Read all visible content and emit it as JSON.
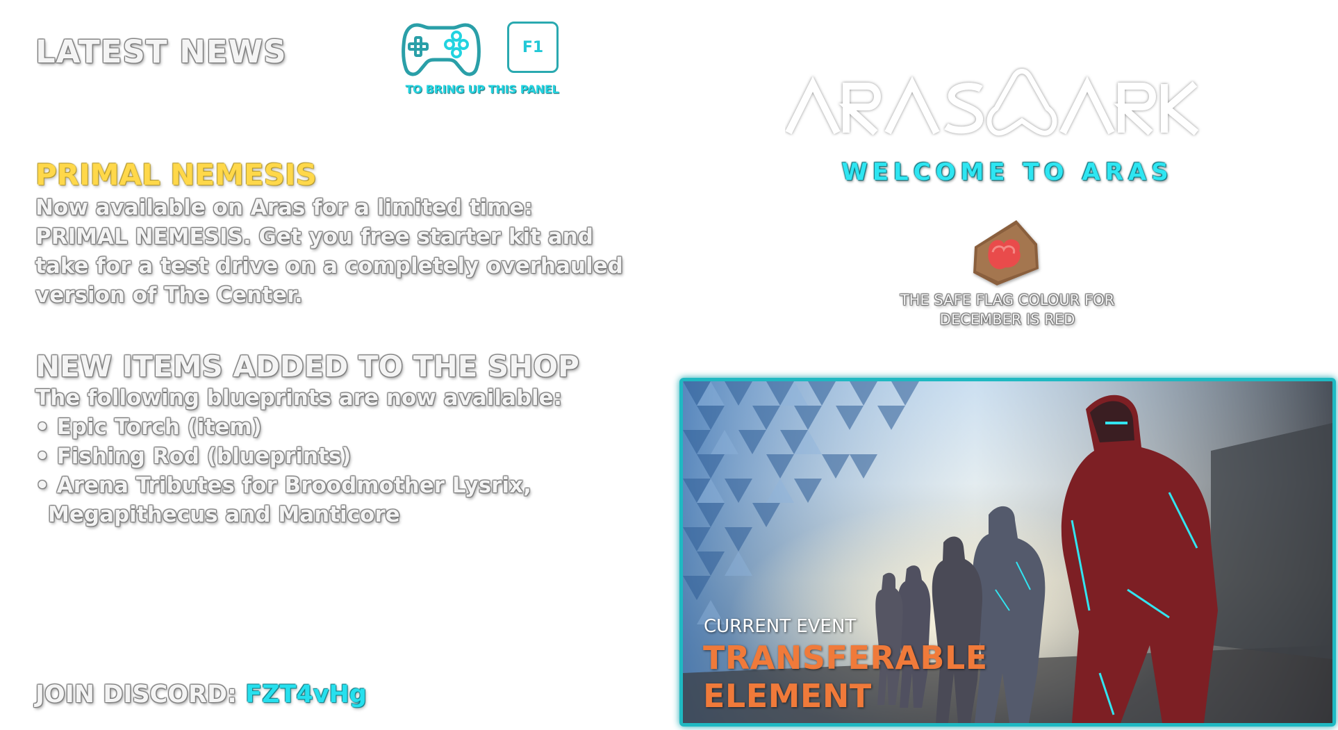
{
  "header": {
    "title": "LATEST NEWS",
    "hint_label": "TO BRING UP THIS PANEL",
    "key_label": "F1",
    "controller_icon": "gamepad-icon"
  },
  "news": [
    {
      "title": "PRIMAL NEMESIS",
      "body": "Now available on Aras for a limited time: PRIMAL NEMESIS. Get you free starter kit and take for a test drive on a completely overhauled version of The Center."
    },
    {
      "title": "NEW ITEMS ADDED TO THE SHOP",
      "intro": "The following blueprints are now available:",
      "items": [
        "• Epic Torch (item)",
        "• Fishing Rod (blueprints)",
        "• Arena Tributes for Broodmother Lysrix,",
        "Megapithecus and Manticore"
      ]
    }
  ],
  "discord": {
    "label": "JOIN DISCORD:",
    "code": "FZT4vHg"
  },
  "branding": {
    "logo_left": "ARAS",
    "logo_right": "ARK",
    "welcome": "WELCOME TO ARAS"
  },
  "safe_flag": {
    "line1": "THE SAFE FLAG COLOUR FOR",
    "line2": "DECEMBER  IS RED",
    "icon": "flag-icon"
  },
  "event": {
    "label": "CURRENT EVENT",
    "name_line1": "TRANSFERABLE",
    "name_line2": "ELEMENT"
  },
  "colors": {
    "accent_cyan": "#22d3e0",
    "news_title_yellow": "#ffd84a",
    "event_orange": "#f07a3a",
    "flag_red": "#e94c4c"
  }
}
